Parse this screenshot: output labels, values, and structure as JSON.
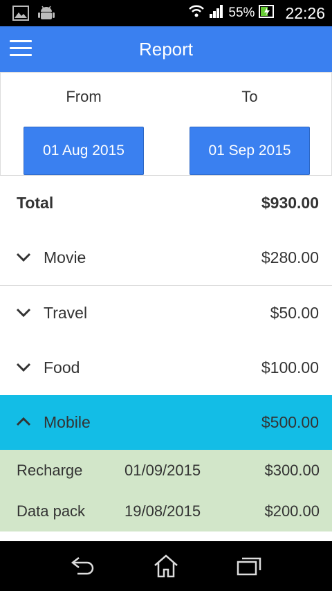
{
  "status_bar": {
    "battery": "55%",
    "time": "22:26",
    "icons": [
      "image-icon",
      "android-icon",
      "wifi-icon",
      "signal-icon",
      "battery-icon"
    ]
  },
  "app_bar": {
    "title": "Report",
    "menu_icon": "menu-icon"
  },
  "date_range": {
    "from_label": "From",
    "from_value": "01 Aug 2015",
    "to_label": "To",
    "to_value": "01 Sep 2015"
  },
  "total": {
    "label": "Total",
    "amount": "$930.00"
  },
  "categories": [
    {
      "name": "Movie",
      "amount": "$280.00",
      "expanded": false
    },
    {
      "name": "Travel",
      "amount": "$50.00",
      "expanded": false
    },
    {
      "name": "Food",
      "amount": "$100.00",
      "expanded": false
    },
    {
      "name": "Mobile",
      "amount": "$500.00",
      "expanded": true
    }
  ],
  "mobile_items": [
    {
      "name": "Recharge",
      "date": "01/09/2015",
      "amount": "$300.00"
    },
    {
      "name": "Data pack",
      "date": "19/08/2015",
      "amount": "$200.00"
    }
  ],
  "nav_bar": {
    "buttons": [
      "back-icon",
      "home-icon",
      "recent-apps-icon"
    ]
  },
  "colors": {
    "primary": "#3a80f0",
    "active_category": "#13bde6",
    "detail_background": "#d2e6c9"
  }
}
